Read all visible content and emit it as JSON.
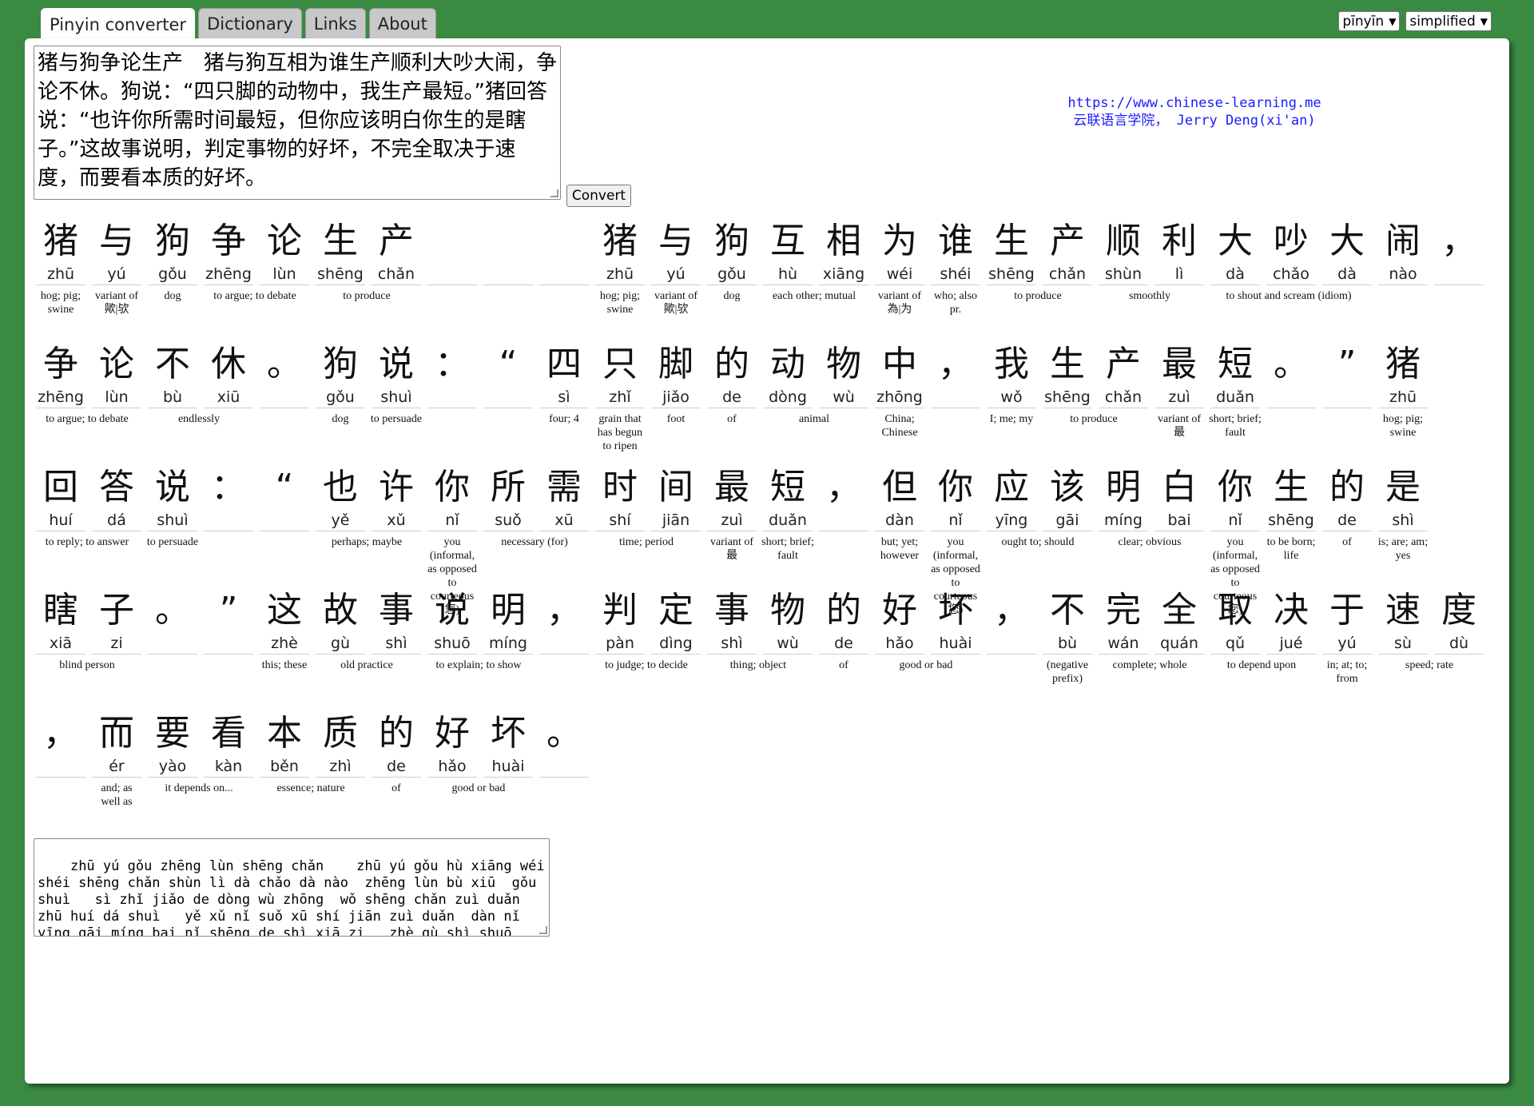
{
  "tabs": [
    "Pinyin converter",
    "Dictionary",
    "Links",
    "About"
  ],
  "selects": {
    "mode": "pīnyīn",
    "script": "simplified"
  },
  "input_text": "猪与狗争论生产　猪与狗互相为谁生产顺利大吵大闹，争论不休。狗说：“四只脚的动物中，我生产最短。”猪回答说：“也许你所需时间最短，但你应该明白你生的是瞎子。”这故事说明，判定事物的好坏，不完全取决于速度，而要看本质的好坏。",
  "convert_label": "Convert",
  "credit": {
    "url": "https://www.chinese-learning.me",
    "org": "云联语言学院， Jerry Deng(xi'an)"
  },
  "rows": [
    [
      [
        "猪",
        "zhū",
        "hog; pig; swine"
      ],
      [
        "与",
        "yú",
        "variant of 歟|欤"
      ],
      [
        "狗",
        "gǒu",
        "dog"
      ],
      [
        "争",
        "zhēng",
        "to argue; to debate"
      ],
      [
        "论",
        "lùn",
        ""
      ],
      [
        "生",
        "shēng",
        "to produce"
      ],
      [
        "产",
        "chǎn",
        ""
      ],
      [
        "",
        "",
        ""
      ],
      [
        "",
        "",
        ""
      ],
      [
        "",
        "",
        ""
      ],
      [
        "猪",
        "zhū",
        "hog; pig; swine"
      ],
      [
        "与",
        "yú",
        "variant of 歟|欤"
      ],
      [
        "狗",
        "gǒu",
        "dog"
      ],
      [
        "互",
        "hù",
        "each other; mutual"
      ],
      [
        "相",
        "xiāng",
        ""
      ],
      [
        "为",
        "wéi",
        "variant of 為|为"
      ],
      [
        "谁",
        "shéi",
        "who; also pr."
      ],
      [
        "生",
        "shēng",
        "to produce"
      ],
      [
        "产",
        "chǎn",
        ""
      ],
      [
        "顺",
        "shùn",
        "smoothly"
      ],
      [
        "利",
        "lì",
        ""
      ],
      [
        "大",
        "dà",
        "to shout and scream (idiom)"
      ],
      [
        "吵",
        "chǎo",
        ""
      ],
      [
        "大",
        "dà",
        ""
      ],
      [
        "闹",
        "nào",
        ""
      ],
      [
        "，",
        "",
        ""
      ]
    ],
    [
      [
        "争",
        "zhēng",
        "to argue; to debate"
      ],
      [
        "论",
        "lùn",
        ""
      ],
      [
        "不",
        "bù",
        "endlessly"
      ],
      [
        "休",
        "xiū",
        ""
      ],
      [
        "。",
        "",
        ""
      ],
      [
        "狗",
        "gǒu",
        "dog"
      ],
      [
        "说",
        "shuì",
        "to persuade"
      ],
      [
        "：",
        "",
        ""
      ],
      [
        "“",
        "",
        ""
      ],
      [
        "四",
        "sì",
        "four; 4"
      ],
      [
        "只",
        "zhǐ",
        "grain that has begun to ripen"
      ],
      [
        "脚",
        "jiǎo",
        "foot"
      ],
      [
        "的",
        "de",
        "of"
      ],
      [
        "动",
        "dòng",
        "animal"
      ],
      [
        "物",
        "wù",
        ""
      ],
      [
        "中",
        "zhōng",
        "China; Chinese"
      ],
      [
        "，",
        "",
        ""
      ],
      [
        "我",
        "wǒ",
        "I; me; my"
      ],
      [
        "生",
        "shēng",
        "to produce"
      ],
      [
        "产",
        "chǎn",
        ""
      ],
      [
        "最",
        "zuì",
        "variant of 最"
      ],
      [
        "短",
        "duǎn",
        "short; brief; fault"
      ],
      [
        "。",
        "",
        ""
      ],
      [
        "”",
        "",
        ""
      ],
      [
        "猪",
        "zhū",
        "hog; pig; swine"
      ]
    ],
    [
      [
        "回",
        "huí",
        "to reply; to answer"
      ],
      [
        "答",
        "dá",
        ""
      ],
      [
        "说",
        "shuì",
        "to persuade"
      ],
      [
        "：",
        "",
        ""
      ],
      [
        "“",
        "",
        ""
      ],
      [
        "也",
        "yě",
        "perhaps; maybe"
      ],
      [
        "许",
        "xǔ",
        ""
      ],
      [
        "你",
        "nǐ",
        "you (informal, as opposed to courteous 您)"
      ],
      [
        "所",
        "suǒ",
        "necessary (for)"
      ],
      [
        "需",
        "xū",
        ""
      ],
      [
        "时",
        "shí",
        "time; period"
      ],
      [
        "间",
        "jiān",
        ""
      ],
      [
        "最",
        "zuì",
        "variant of 最"
      ],
      [
        "短",
        "duǎn",
        "short; brief; fault"
      ],
      [
        "，",
        "",
        ""
      ],
      [
        "但",
        "dàn",
        "but; yet; however"
      ],
      [
        "你",
        "nǐ",
        "you (informal, as opposed to courteous 您)"
      ],
      [
        "应",
        "yīng",
        "ought to; should"
      ],
      [
        "该",
        "gāi",
        ""
      ],
      [
        "明",
        "míng",
        "clear; obvious"
      ],
      [
        "白",
        "bai",
        ""
      ],
      [
        "你",
        "nǐ",
        "you (informal, as opposed to courteous 您)"
      ],
      [
        "生",
        "shēng",
        "to be born; life"
      ],
      [
        "的",
        "de",
        "of"
      ],
      [
        "是",
        "shì",
        "is; are; am; yes"
      ]
    ],
    [
      [
        "瞎",
        "xiā",
        "blind person"
      ],
      [
        "子",
        "zi",
        ""
      ],
      [
        "。",
        "",
        ""
      ],
      [
        "”",
        "",
        ""
      ],
      [
        "这",
        "zhè",
        "this; these"
      ],
      [
        "故",
        "gù",
        "old practice"
      ],
      [
        "事",
        "shì",
        ""
      ],
      [
        "说",
        "shuō",
        "to explain; to show"
      ],
      [
        "明",
        "míng",
        ""
      ],
      [
        "，",
        "",
        ""
      ],
      [
        "判",
        "pàn",
        "to judge; to decide"
      ],
      [
        "定",
        "dìng",
        ""
      ],
      [
        "事",
        "shì",
        "thing; object"
      ],
      [
        "物",
        "wù",
        ""
      ],
      [
        "的",
        "de",
        "of"
      ],
      [
        "好",
        "hǎo",
        "good or bad"
      ],
      [
        "坏",
        "huài",
        ""
      ],
      [
        "，",
        "",
        ""
      ],
      [
        "不",
        "bù",
        "(negative prefix)"
      ],
      [
        "完",
        "wán",
        "complete; whole"
      ],
      [
        "全",
        "quán",
        ""
      ],
      [
        "取",
        "qǔ",
        "to depend upon"
      ],
      [
        "决",
        "jué",
        ""
      ],
      [
        "于",
        "yú",
        "in; at; to; from"
      ],
      [
        "速",
        "sù",
        "speed; rate"
      ],
      [
        "度",
        "dù",
        ""
      ]
    ],
    [
      [
        "，",
        "",
        ""
      ],
      [
        "而",
        "ér",
        "and; as well as"
      ],
      [
        "要",
        "yào",
        "it depends on..."
      ],
      [
        "看",
        "kàn",
        ""
      ],
      [
        "本",
        "běn",
        "essence; nature"
      ],
      [
        "质",
        "zhì",
        ""
      ],
      [
        "的",
        "de",
        "of"
      ],
      [
        "好",
        "hǎo",
        "good or bad"
      ],
      [
        "坏",
        "huài",
        ""
      ],
      [
        "。",
        "",
        ""
      ]
    ]
  ],
  "output_text": "zhū yú gǒu zhēng lùn shēng chǎn    zhū yú gǒu hù xiāng wéi\nshéi shēng chǎn shùn lì dà chǎo dà nào  zhēng lùn bù xiū  gǒu\nshuì   sì zhǐ jiǎo de dòng wù zhōng  wǒ shēng chǎn zuì duǎn\nzhū huí dá shuì   yě xǔ nǐ suǒ xū shí jiān zuì duǎn  dàn nǐ\nyīng gāi míng bai nǐ shēng de shì xiā zi   zhè gù shì shuō\nmíng  pàn dìng shì wù de hǎo huài  bù wán quán qǔ jué yú sù"
}
